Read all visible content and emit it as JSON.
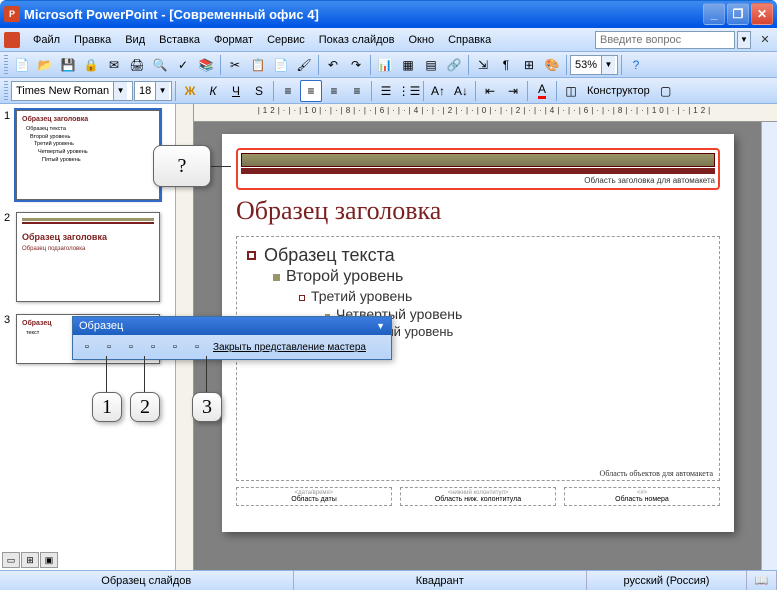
{
  "titlebar": {
    "app": "Microsoft PowerPoint",
    "doc": "[Современный офис 4]"
  },
  "menu": {
    "file": "Файл",
    "edit": "Правка",
    "view": "Вид",
    "insert": "Вставка",
    "format": "Формат",
    "service": "Сервис",
    "slideshow": "Показ слайдов",
    "window": "Окно",
    "help": "Справка",
    "help_placeholder": "Введите вопрос"
  },
  "toolbar": {
    "font": "Times New Roman",
    "size": "18",
    "zoom": "53%",
    "constructor": "Конструктор",
    "bold": "Ж",
    "italic": "К",
    "underline": "Ч",
    "shadow": "S"
  },
  "ruler": "|12|·|·|10|·|·|8|·|·|6|·|·|4|·|·|2|·|·|0|·|·|2|·|·|4|·|·|6|·|·|8|·|·|10|·|·|12|",
  "thumbs": {
    "t1": {
      "title": "Образец заголовка",
      "l1": "Образец текста",
      "l2": "Второй уровень",
      "l3": "Третий уровень",
      "l4": "Четвертый уровень",
      "l5": "Пятый уровень"
    },
    "t2": {
      "title": "Образец заголовка",
      "l1": "Образец подзаголовка"
    },
    "t3": {
      "title": "Образец",
      "l1": "текст"
    }
  },
  "slide": {
    "title_area_label": "Область заголовка для автомакета",
    "title": "Образец заголовка",
    "l1": "Образец текста",
    "l2": "Второй уровень",
    "l3": "Третий уровень",
    "l4": "Четвертый уровень",
    "l5": "Пятый уровень",
    "content_label": "Область объектов для автомакета",
    "footer": {
      "date_lbl": "<дата/время>",
      "date": "Область даты",
      "ftr_lbl": "<нижний колонтитул>",
      "ftr": "Область ниж. колонтитула",
      "num_lbl": "<#>",
      "num": "Область номера"
    }
  },
  "master_toolbar": {
    "title": "Образец",
    "close": "Закрыть представление мастера"
  },
  "callouts": {
    "q": "?",
    "c1": "1",
    "c2": "2",
    "c3": "3"
  },
  "status": {
    "s1": "Образец слайдов",
    "s2": "Квадрант",
    "s3": "русский (Россия)"
  }
}
